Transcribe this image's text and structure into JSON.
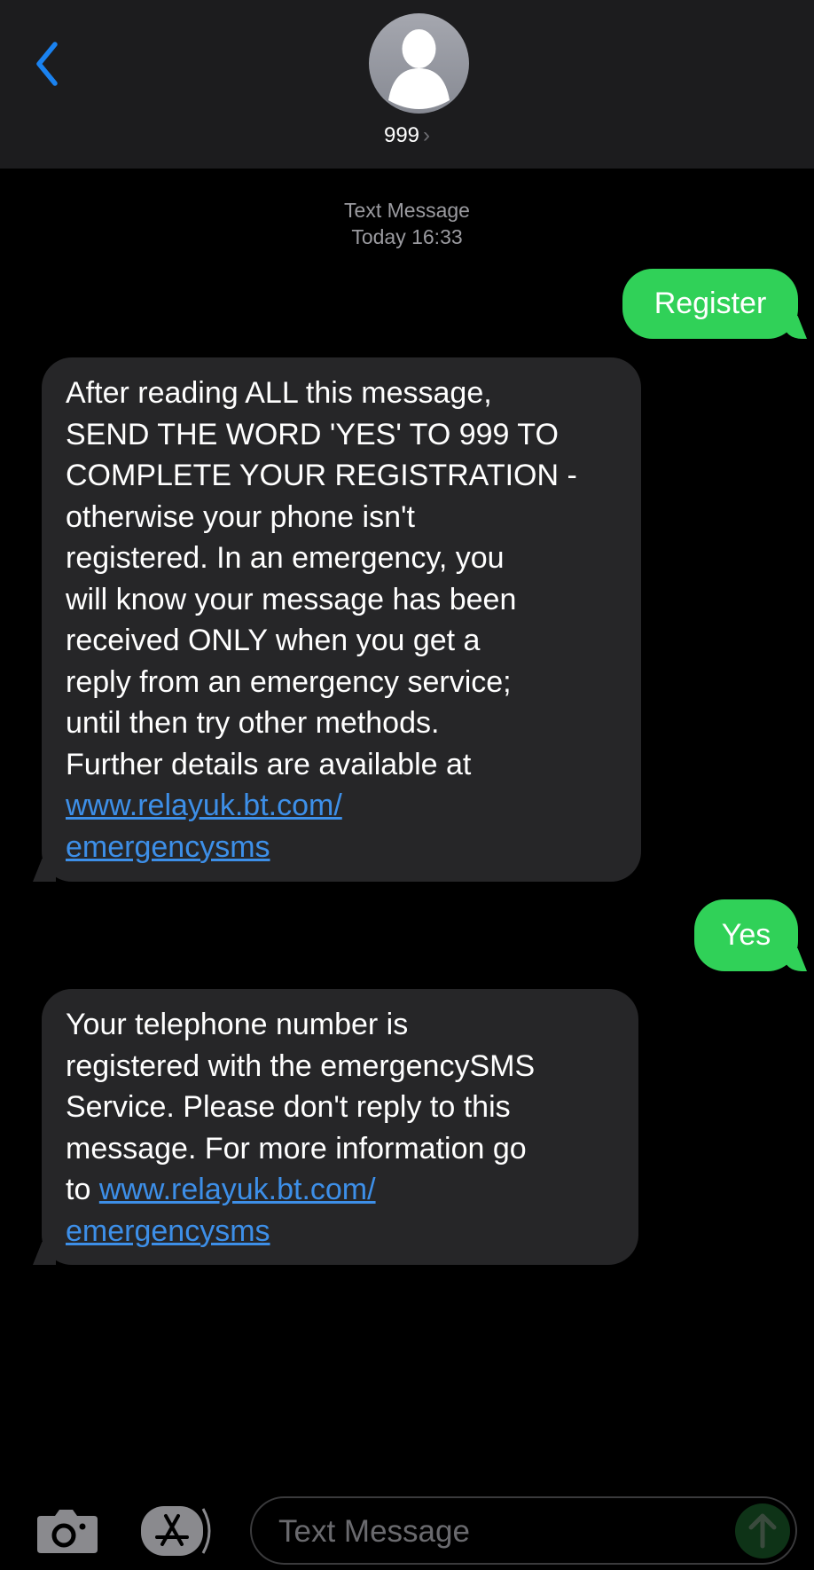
{
  "header": {
    "contact_name": "999",
    "contact_chevron": "›",
    "back_icon": "chevron-left-icon",
    "accent": "#1a82f0"
  },
  "meta": {
    "service": "Text Message",
    "time": "Today 16:33"
  },
  "messages": [
    {
      "direction": "outgoing",
      "text": "Register"
    },
    {
      "direction": "incoming",
      "lines": [
        "After reading ALL this message,",
        "SEND THE WORD 'YES' TO 999 TO",
        "COMPLETE YOUR REGISTRATION -",
        "otherwise your phone isn't",
        "registered. In an emergency, you",
        "will know your message has been",
        "received ONLY when you get a",
        "reply from an emergency service;",
        "until then try other methods.",
        "Further details are available at"
      ],
      "link_lines": [
        "www.relayuk.bt.com/",
        "emergencysms"
      ]
    },
    {
      "direction": "outgoing",
      "text": "Yes"
    },
    {
      "direction": "incoming",
      "lines": [
        "Your telephone number is",
        "registered with the emergencySMS",
        "Service. Please don't reply to this",
        "message. For more information go"
      ],
      "prefix": "to ",
      "link_lines": [
        "www.relayuk.bt.com/",
        "emergencysms"
      ]
    }
  ],
  "composer": {
    "placeholder": "Text Message",
    "camera_icon": "camera-icon",
    "apps_icon": "app-store-icon",
    "send_icon": "arrow-up-icon"
  },
  "colors": {
    "outgoing": "#30d158",
    "incoming": "#262628",
    "link": "#3d8fe8"
  }
}
